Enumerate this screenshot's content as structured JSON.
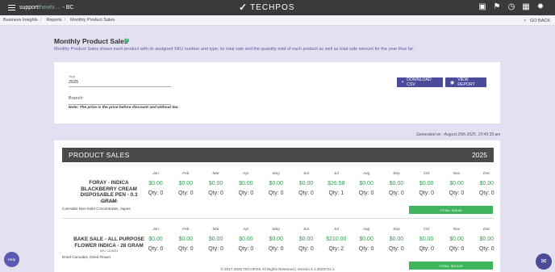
{
  "topbar": {
    "brand_main": "support",
    "brand_faint": "thewhi...",
    "store": "- BC",
    "logo_text": "TECHPOS",
    "icons": [
      "register-icon",
      "tag-icon",
      "clock-icon",
      "calendar-icon",
      "gear-icon"
    ]
  },
  "breadcrumb": {
    "items": [
      "Business Insights",
      "Reports",
      "Monthly Product Sales"
    ],
    "go_back": "GO BACK"
  },
  "page": {
    "title": "Monthly Product Sales",
    "description": "Monthly Product Sales shows each product with its assigned SKU number and type, its total sale and the quantity sold of each product as well as total sale amount for the year thus far."
  },
  "filters": {
    "year_label": "Year",
    "year_value": "2025",
    "branch_label": "Branch:",
    "note": "Note: The price is the price before discount and without tax.",
    "download_csv": "DOWNLOAD CSV",
    "view_report": "VIEW REPORT"
  },
  "report": {
    "generated": "Generated on : August 20th 2025, 10:49:39 am",
    "header_title": "PRODUCT SALES",
    "header_year": "2025",
    "months": [
      "Jan",
      "Feb",
      "Mar",
      "Apr",
      "May",
      "Jun",
      "Jul",
      "Aug",
      "Sep",
      "Oct",
      "Nov",
      "Dec"
    ],
    "products": [
      {
        "name_line1": "FORAY - INDICA",
        "name_line2": "BLACKBERRY CREAM",
        "name_line3": "DISPOSABLE PEN - 0.3 GRAM",
        "sku": "SKU: 1014847",
        "type": "Cannabis Non-Solid Concentrates, Vapes",
        "amounts": [
          "$0.00",
          "$0.00",
          "$0.00",
          "$0.00",
          "$0.00",
          "$0.00",
          "$26.58",
          "$0.00",
          "$0.00",
          "$0.00",
          "$0.00",
          "$0.00"
        ],
        "qtys": [
          "Qty: 0",
          "Qty: 0",
          "Qty: 0",
          "Qty: 0",
          "Qty: 0",
          "Qty: 0",
          "Qty: 1",
          "Qty: 0",
          "Qty: 0",
          "Qty: 0",
          "Qty: 0",
          "Qty: 0"
        ],
        "total": "TOTAL: $26.58"
      },
      {
        "name_line1": "BAKE SALE - ALL PURPOSE",
        "name_line2": "FLOWER INDICA - 28 GRAM",
        "name_line3": "",
        "sku": "SKU: 1104834",
        "type": "Dried Cannabis, Dried Flower",
        "amounts": [
          "$0.00",
          "$0.00",
          "$0.00",
          "$0.00",
          "$0.00",
          "$0.00",
          "$210.00",
          "$0.00",
          "$0.00",
          "$0.00",
          "$0.00",
          "$0.00"
        ],
        "qtys": [
          "Qty: 0",
          "Qty: 0",
          "Qty: 0",
          "Qty: 0",
          "Qty: 0",
          "Qty: 0",
          "Qty: 2",
          "Qty: 0",
          "Qty: 0",
          "Qty: 0",
          "Qty: 0",
          "Qty: 0"
        ],
        "total": "TOTAL: $210.00"
      }
    ]
  },
  "footer": {
    "text": "© 2017-2025 TECHPOS All Rights Reserved | Version 4.1.2025724.1"
  },
  "help_label": "Help",
  "colors": {
    "topbar": "#3a3a3a",
    "accent": "#4b4b9a",
    "green": "#3fb45f",
    "page_bg": "#e3e1f1"
  }
}
